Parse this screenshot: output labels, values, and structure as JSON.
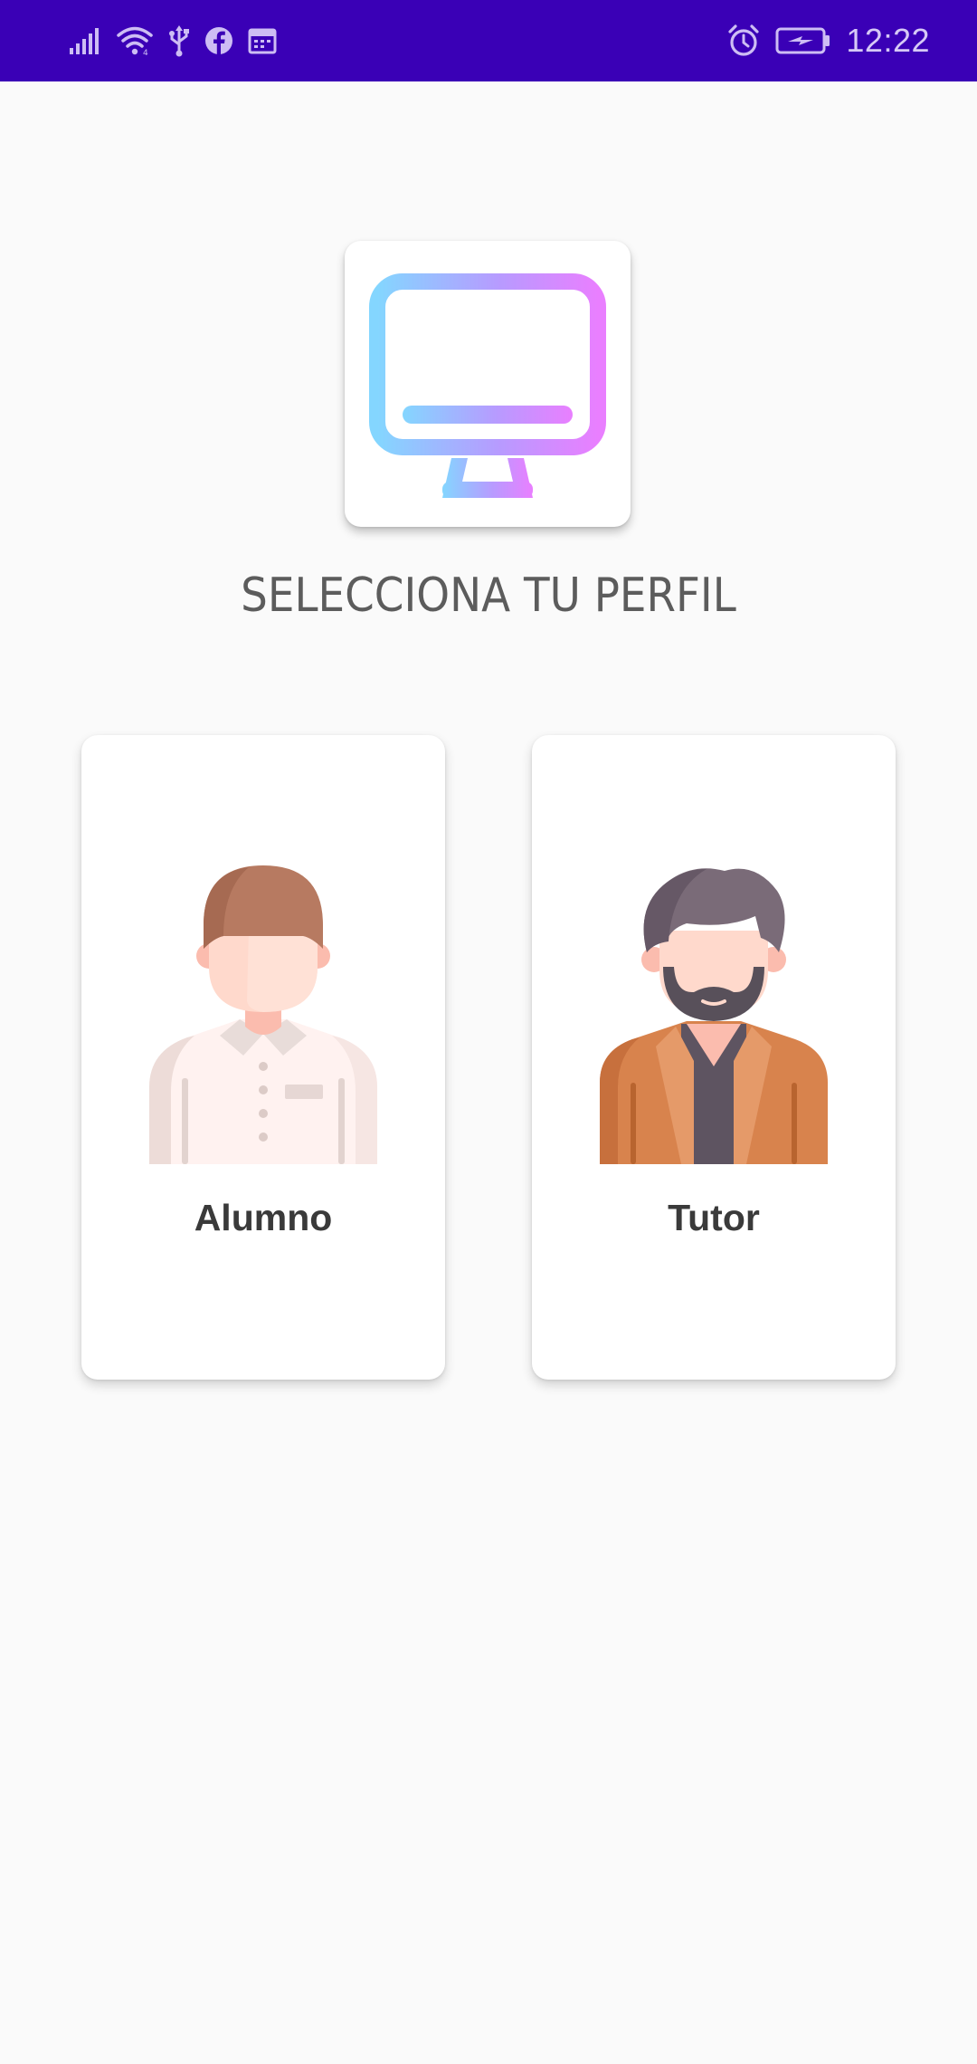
{
  "status_bar": {
    "time": "12:22",
    "left_icons": [
      "signal-icon",
      "wifi-icon",
      "usb-icon",
      "facebook-icon",
      "calendar-icon"
    ],
    "right_icons": [
      "alarm-icon",
      "battery-charging-icon"
    ],
    "background": "#3a00b6"
  },
  "logo": {
    "icon": "monitor-icon",
    "gradient": [
      "#84d6ff",
      "#b79bff",
      "#e97fff"
    ]
  },
  "heading": "SELECCIONA TU PERFIL",
  "profiles": [
    {
      "label": "Alumno",
      "icon": "student-avatar-icon"
    },
    {
      "label": "Tutor",
      "icon": "tutor-avatar-icon"
    }
  ]
}
